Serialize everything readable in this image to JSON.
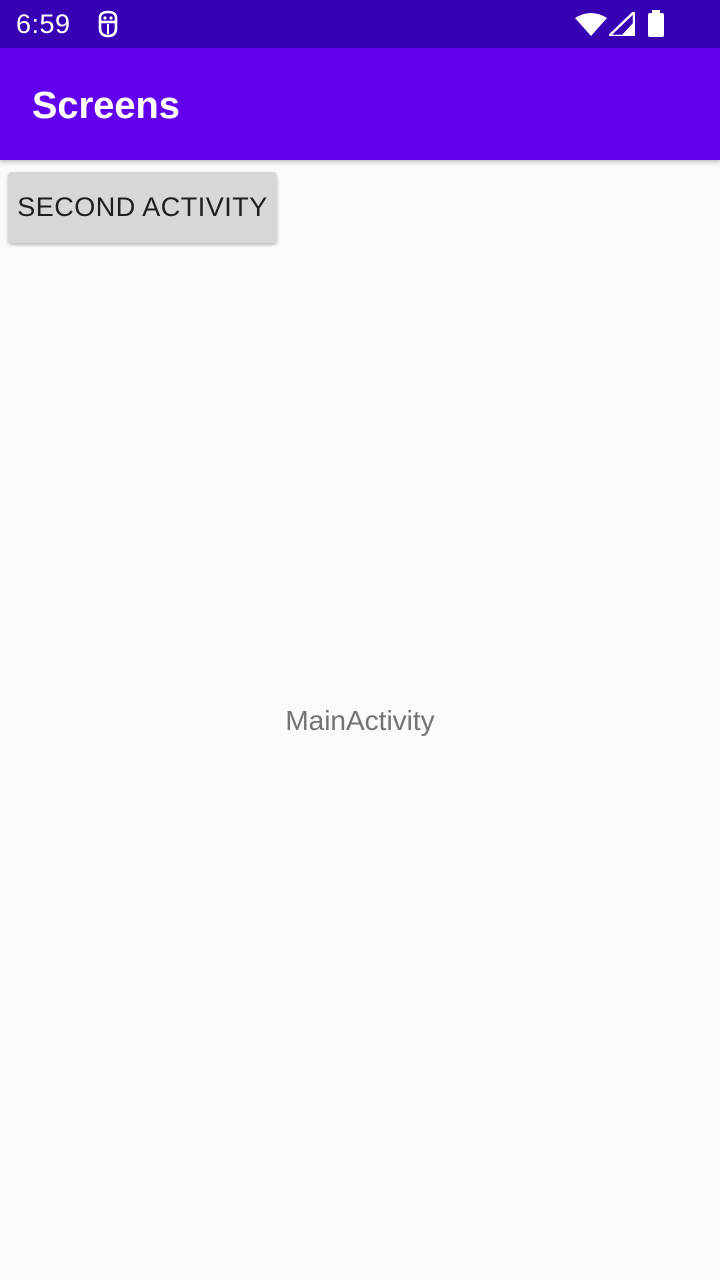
{
  "status_bar": {
    "time": "6:59",
    "icons": [
      "android-debug-icon",
      "wifi-icon",
      "cell-signal-icon",
      "battery-icon"
    ],
    "background_color": "#3700b3"
  },
  "app_bar": {
    "title": "Screens",
    "background_color": "#6200ee"
  },
  "content": {
    "button_label": "SECOND ACTIVITY",
    "center_label": "MainActivity",
    "background_color": "#fafafa"
  }
}
